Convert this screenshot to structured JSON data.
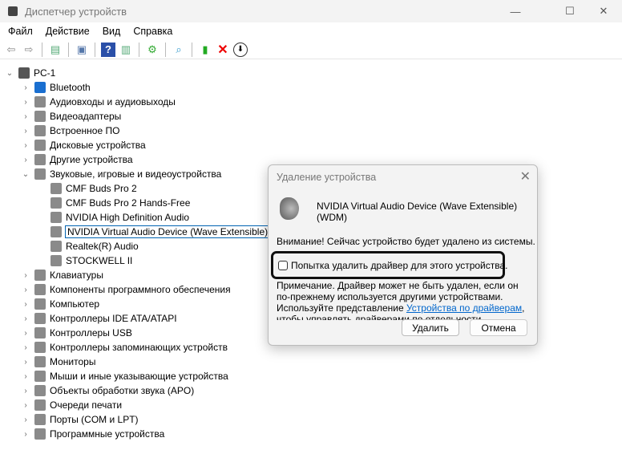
{
  "window": {
    "title": "Диспетчер устройств",
    "minimize": "—",
    "maximize": "☐",
    "close": "✕"
  },
  "menu": [
    "Файл",
    "Действие",
    "Вид",
    "Справка"
  ],
  "toolbar_icons": [
    "back-icon",
    "forward-icon",
    "show-hide-tree-icon",
    "properties-icon",
    "help-icon",
    "view-icon",
    "update-driver-icon",
    "scan-hardware-icon",
    "enable-device-icon",
    "uninstall-icon",
    "disable-icon"
  ],
  "tree": {
    "root": "PC-1",
    "items": [
      {
        "label": "Bluetooth",
        "level": 1,
        "expanded": false
      },
      {
        "label": "Аудиовходы и аудиовыходы",
        "level": 1,
        "expanded": false
      },
      {
        "label": "Видеоадаптеры",
        "level": 1,
        "expanded": false
      },
      {
        "label": "Встроенное ПО",
        "level": 1,
        "expanded": false
      },
      {
        "label": "Дисковые устройства",
        "level": 1,
        "expanded": false
      },
      {
        "label": "Другие устройства",
        "level": 1,
        "expanded": false
      },
      {
        "label": "Звуковые, игровые и видеоустройства",
        "level": 1,
        "expanded": true
      },
      {
        "label": "CMF Buds Pro 2",
        "level": 2
      },
      {
        "label": "CMF Buds Pro 2 Hands-Free",
        "level": 2
      },
      {
        "label": "NVIDIA High Definition Audio",
        "level": 2
      },
      {
        "label": "NVIDIA Virtual Audio Device (Wave Extensible) (WDM)",
        "level": 2,
        "selected": true
      },
      {
        "label": "Realtek(R) Audio",
        "level": 2
      },
      {
        "label": "STOCKWELL II",
        "level": 2
      },
      {
        "label": "Клавиатуры",
        "level": 1,
        "expanded": false
      },
      {
        "label": "Компоненты программного обеспечения",
        "level": 1,
        "expanded": false
      },
      {
        "label": "Компьютер",
        "level": 1,
        "expanded": false
      },
      {
        "label": "Контроллеры IDE ATA/ATAPI",
        "level": 1,
        "expanded": false
      },
      {
        "label": "Контроллеры USB",
        "level": 1,
        "expanded": false
      },
      {
        "label": "Контроллеры запоминающих устройств",
        "level": 1,
        "expanded": false
      },
      {
        "label": "Мониторы",
        "level": 1,
        "expanded": false
      },
      {
        "label": "Мыши и иные указывающие устройства",
        "level": 1,
        "expanded": false
      },
      {
        "label": "Объекты обработки звука (APO)",
        "level": 1,
        "expanded": false
      },
      {
        "label": "Очереди печати",
        "level": 1,
        "expanded": false
      },
      {
        "label": "Порты (COM и LPT)",
        "level": 1,
        "expanded": false
      },
      {
        "label": "Программные устройства",
        "level": 1,
        "expanded": false
      }
    ]
  },
  "dialog": {
    "title": "Удаление устройства",
    "close": "✕",
    "device": "NVIDIA Virtual Audio Device (Wave Extensible) (WDM)",
    "warning": "Внимание! Сейчас устройство будет удалено из системы.",
    "checkbox_label": "Попытка удалить драйвер для этого устройства.",
    "checkbox_checked": false,
    "note_before": "Примечание. Драйвер может не быть удален, если он по-прежнему используется другими устройствами. Используйте представление ",
    "note_link": "Устройства по драйверам",
    "note_after": ", чтобы управлять драйверами по отдельности.",
    "ok": "Удалить",
    "cancel": "Отмена"
  }
}
